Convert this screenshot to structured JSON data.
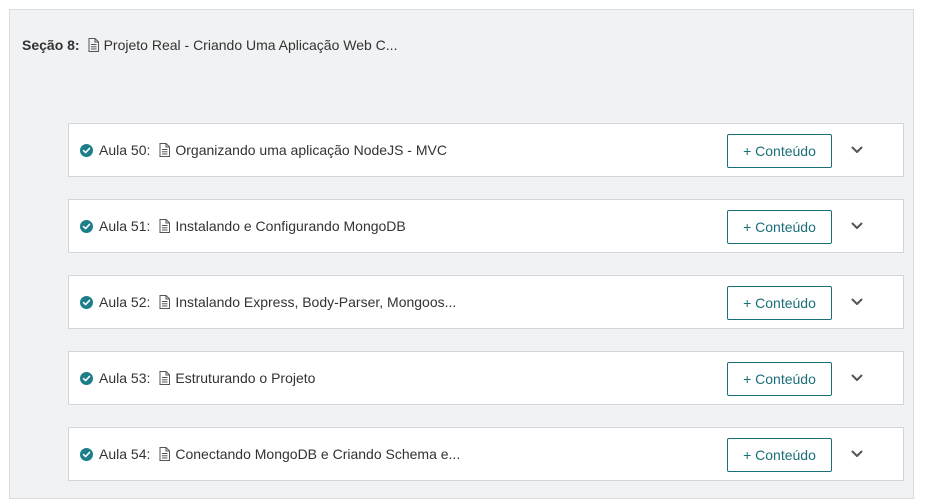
{
  "section": {
    "label": "Seção 8:",
    "title": "Projeto Real - Criando Uma Aplicação Web C..."
  },
  "lessons": [
    {
      "label": "Aula 50:",
      "title": "Organizando uma aplicação NodeJS - MVC",
      "button": "+ Conteúdo"
    },
    {
      "label": "Aula 51:",
      "title": "Instalando e Configurando MongoDB",
      "button": "+ Conteúdo"
    },
    {
      "label": "Aula 52:",
      "title": "Instalando Express, Body-Parser, Mongoos...",
      "button": "+ Conteúdo"
    },
    {
      "label": "Aula 53:",
      "title": "Estruturando o Projeto",
      "button": "+ Conteúdo"
    },
    {
      "label": "Aula 54:",
      "title": "Conectando MongoDB e Criando Schema e...",
      "button": "+ Conteúdo"
    }
  ],
  "colors": {
    "accent": "#1b6f78",
    "check": "#1b7e89",
    "panel_bg": "#f1f2f3"
  },
  "icons": {
    "completed": "check-circle-icon",
    "document": "document-icon",
    "expand": "chevron-down-icon"
  }
}
